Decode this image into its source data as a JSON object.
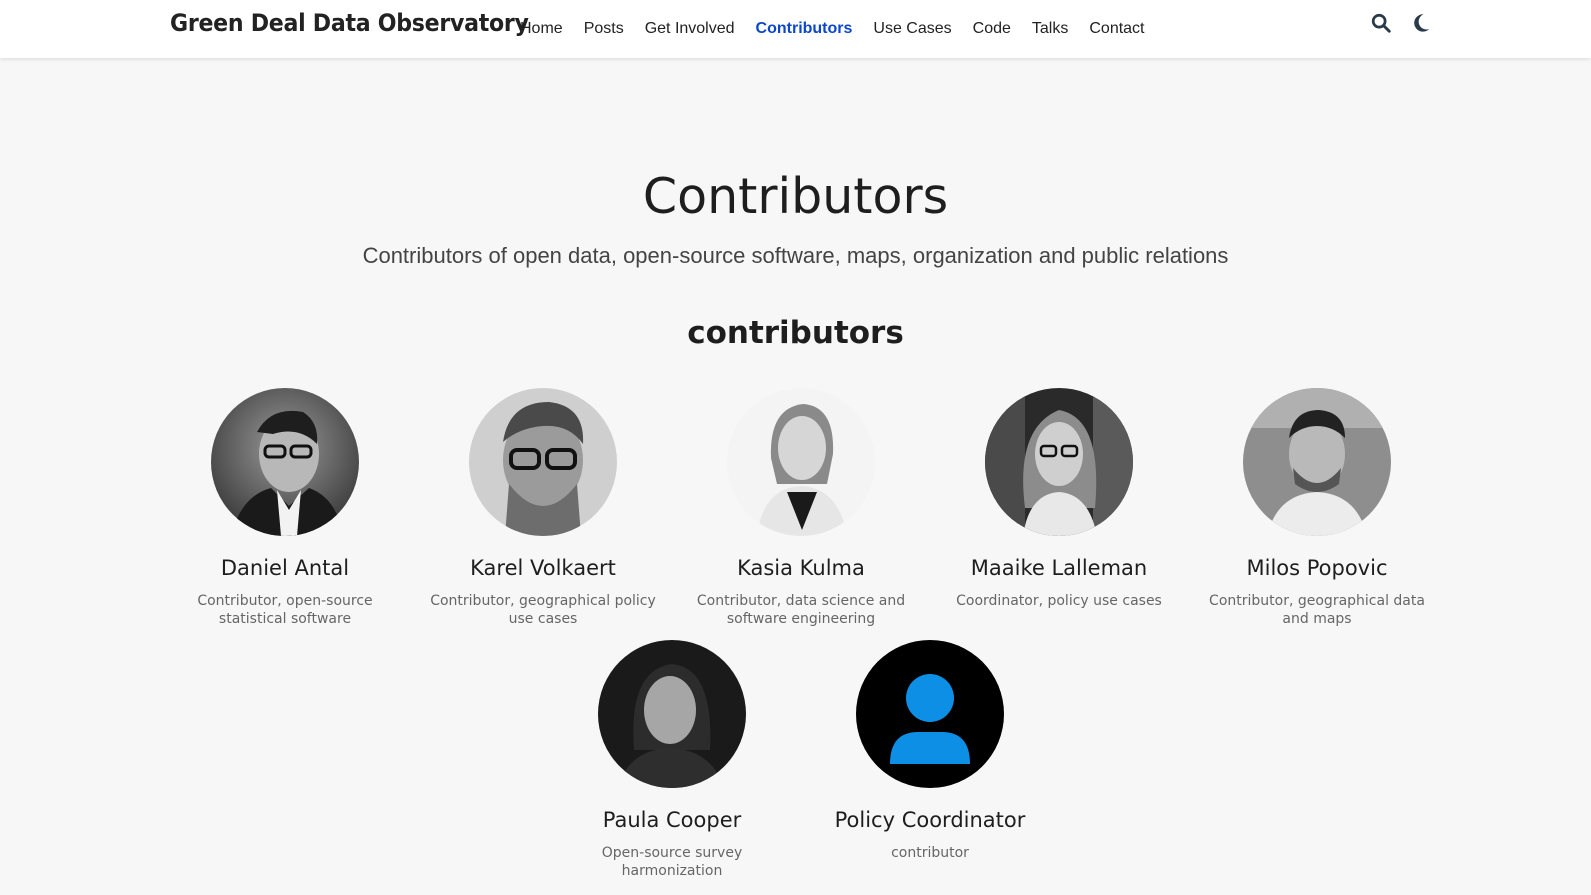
{
  "nav": {
    "brand": "Green Deal Data Observatory",
    "links": [
      "Home",
      "Posts",
      "Get Involved",
      "Contributors",
      "Use Cases",
      "Code",
      "Talks",
      "Contact"
    ],
    "active": "Contributors",
    "active_color": "#0d47c9",
    "icons": [
      "search-icon",
      "moon-icon"
    ]
  },
  "page": {
    "title": "Contributors",
    "subtitle": "Contributors of open data, open-source software, maps, organization and public relations",
    "section_title": "contributors"
  },
  "people": [
    {
      "name": "Daniel Antal",
      "role": "Contributor, open-source statistical software"
    },
    {
      "name": "Karel Volkaert",
      "role": "Contributor, geographical policy use cases"
    },
    {
      "name": "Kasia Kulma",
      "role": "Contributor, data science and software engineering"
    },
    {
      "name": "Maaike Lalleman",
      "role": "Coordinator, policy use cases"
    },
    {
      "name": "Milos Popovic",
      "role": "Contributor, geographical data and maps"
    },
    {
      "name": "Paula Cooper",
      "role": "Open-source survey harmonization"
    },
    {
      "name": "Policy Coordinator",
      "role": "contributor"
    }
  ],
  "colors": {
    "placeholder_avatar_bg": "#000000",
    "placeholder_avatar_fg": "#0d8fe6"
  }
}
